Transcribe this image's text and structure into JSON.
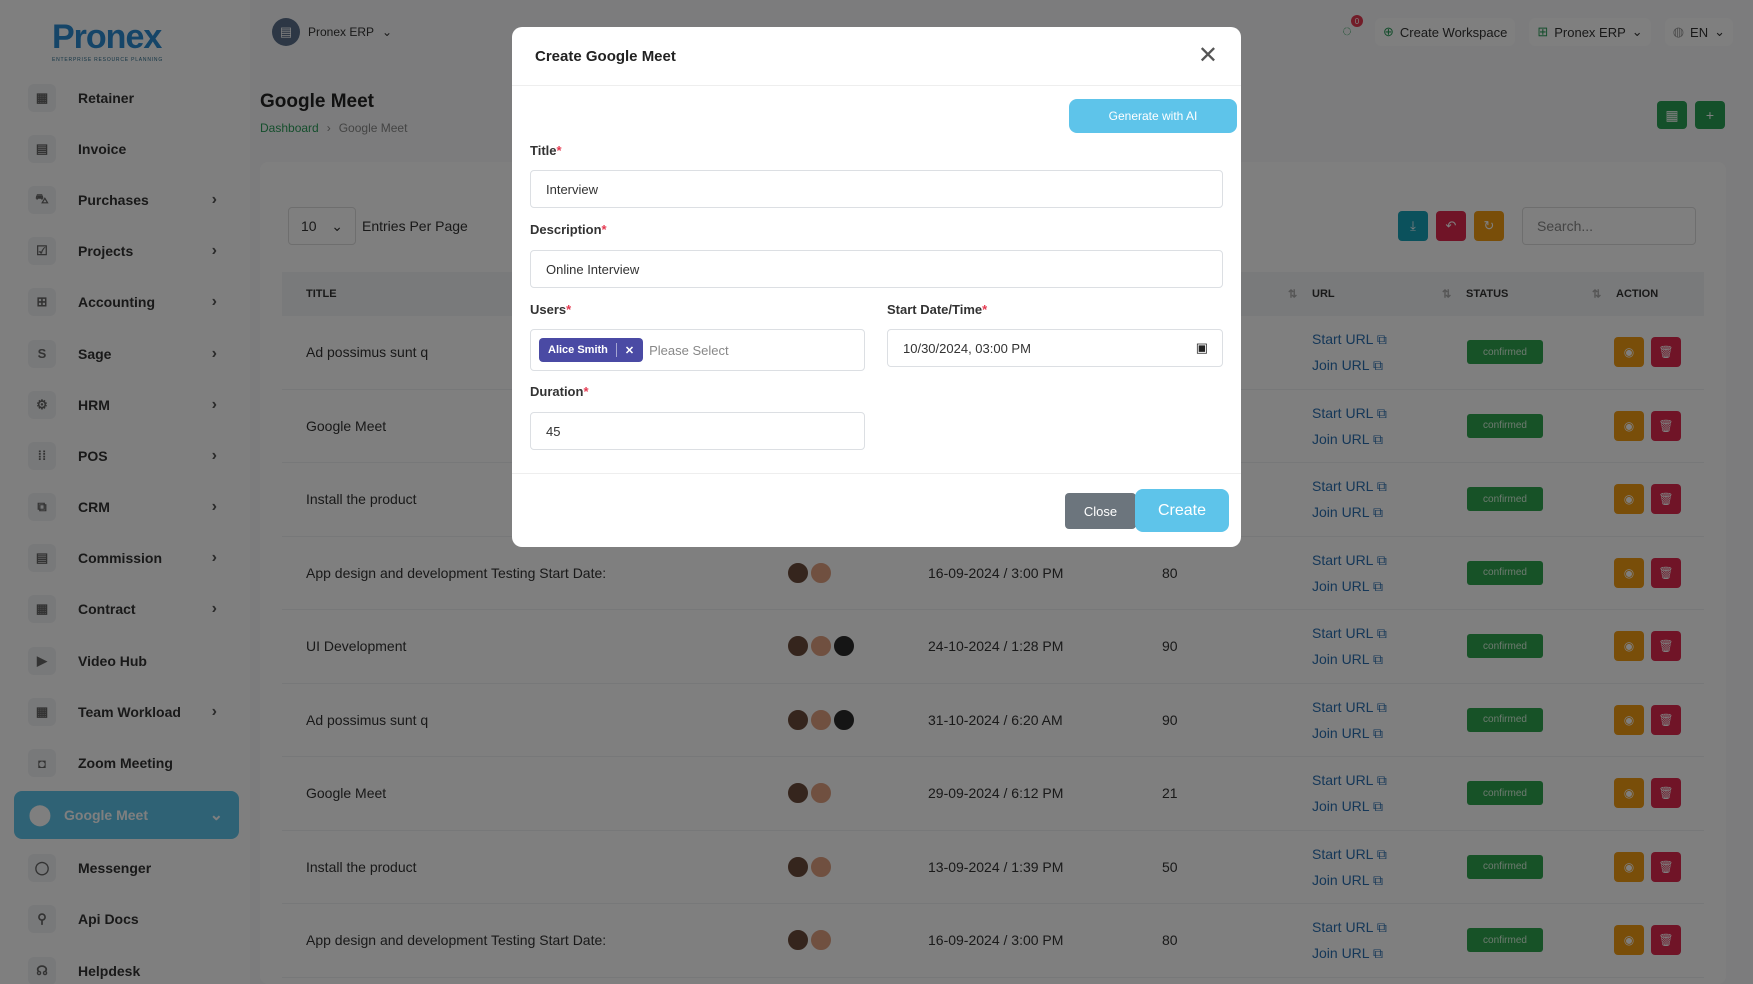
{
  "app": {
    "logo_text": "Pronex",
    "logo_sub": "ENTERPRISE RESOURCE PLANNING"
  },
  "sidebar": {
    "items": [
      {
        "label": "Retainer",
        "icon": "▦",
        "chevron": false
      },
      {
        "label": "Invoice",
        "icon": "▤",
        "chevron": false
      },
      {
        "label": "Purchases",
        "icon": "⛍",
        "chevron": true
      },
      {
        "label": "Projects",
        "icon": "☑",
        "chevron": true
      },
      {
        "label": "Accounting",
        "icon": "⊞",
        "chevron": true
      },
      {
        "label": "Sage",
        "icon": "S",
        "chevron": true
      },
      {
        "label": "HRM",
        "icon": "⚙",
        "chevron": true
      },
      {
        "label": "POS",
        "icon": "⁞⁞",
        "chevron": true
      },
      {
        "label": "CRM",
        "icon": "⧉",
        "chevron": true
      },
      {
        "label": "Commission",
        "icon": "▤",
        "chevron": true
      },
      {
        "label": "Contract",
        "icon": "▦",
        "chevron": true
      },
      {
        "label": "Video Hub",
        "icon": "▶",
        "chevron": false
      },
      {
        "label": "Team Workload",
        "icon": "▦",
        "chevron": true
      },
      {
        "label": "Zoom Meeting",
        "icon": "◘",
        "chevron": false
      }
    ],
    "active": {
      "label": "Google Meet",
      "icon": "⬤"
    },
    "bottom_items": [
      {
        "label": "Messenger",
        "icon": "◯"
      },
      {
        "label": "Api Docs",
        "icon": "⚲"
      },
      {
        "label": "Helpdesk",
        "icon": "☊"
      }
    ]
  },
  "topbar": {
    "workspace": "Pronex ERP",
    "notification_count": "0",
    "create_workspace": "Create Workspace",
    "erp_menu": "Pronex ERP",
    "language": "EN"
  },
  "page": {
    "title": "Google Meet",
    "breadcrumb": [
      "Dashboard",
      "Google Meet"
    ]
  },
  "table": {
    "entries_value": "10",
    "entries_label": "Entries Per Page",
    "search_placeholder": "Search...",
    "headers": {
      "title": "TITLE",
      "url": "URL",
      "status": "STATUS",
      "action": "ACTION"
    },
    "start_url_label": "Start URL",
    "join_url_label": "Join URL",
    "rows": [
      {
        "title": "Ad possimus sunt q",
        "avatars": 0,
        "date": "",
        "duration": "",
        "status": "confirmed"
      },
      {
        "title": "Google Meet",
        "avatars": 0,
        "date": "",
        "duration": "",
        "status": "confirmed"
      },
      {
        "title": "Install the product",
        "avatars": 0,
        "date": "",
        "duration": "",
        "status": "confirmed"
      },
      {
        "title": "App design and development Testing Start Date:",
        "avatars": 2,
        "date": "16-09-2024 / 3:00 PM",
        "duration": "80",
        "status": "confirmed"
      },
      {
        "title": "UI Development",
        "avatars": 3,
        "date": "24-10-2024 / 1:28 PM",
        "duration": "90",
        "status": "confirmed"
      },
      {
        "title": "Ad possimus sunt q",
        "avatars": 3,
        "date": "31-10-2024 / 6:20 AM",
        "duration": "90",
        "status": "confirmed"
      },
      {
        "title": "Google Meet",
        "avatars": 2,
        "date": "29-09-2024 / 6:12 PM",
        "duration": "21",
        "status": "confirmed"
      },
      {
        "title": "Install the product",
        "avatars": 2,
        "date": "13-09-2024 / 1:39 PM",
        "duration": "50",
        "status": "confirmed"
      },
      {
        "title": "App design and development Testing Start Date:",
        "avatars": 2,
        "date": "16-09-2024 / 3:00 PM",
        "duration": "80",
        "status": "confirmed"
      }
    ]
  },
  "modal": {
    "title": "Create Google Meet",
    "generate_label": "Generate with AI",
    "title_label": "Title",
    "title_value": "Interview",
    "description_label": "Description",
    "description_value": "Online Interview",
    "users_label": "Users",
    "users_selected": "Alice Smith",
    "users_placeholder": "Please Select",
    "start_label": "Start Date/Time",
    "start_value": "10/30/2024, 03:00 PM",
    "duration_label": "Duration",
    "duration_value": "45",
    "close_label": "Close",
    "create_label": "Create"
  },
  "colors": {
    "accent": "#5ec4ea",
    "success": "#2ea44f",
    "primary_green": "#28a054",
    "danger": "#e0284f",
    "warning": "#f39c12",
    "chip": "#4a4aa4"
  }
}
